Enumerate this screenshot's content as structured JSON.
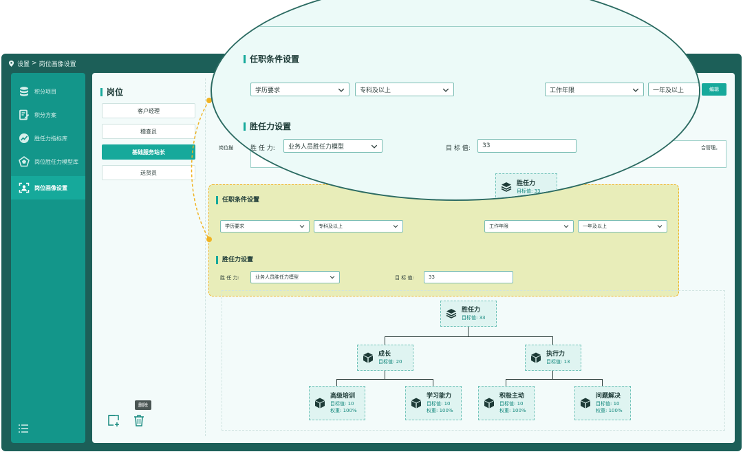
{
  "breadcrumb": {
    "root": "设置",
    "separator": ">",
    "current": "岗位画像设置"
  },
  "sidebar": {
    "items": [
      {
        "label": "积分项目",
        "icon": "database-icon"
      },
      {
        "label": "积分方案",
        "icon": "edit-document-icon"
      },
      {
        "label": "胜任力指标库",
        "icon": "chart-trend-icon"
      },
      {
        "label": "岗位胜任力模型库",
        "icon": "pentagon-icon"
      },
      {
        "label": "岗位画像设置",
        "icon": "portrait-icon",
        "active": true
      }
    ]
  },
  "posts": {
    "title": "岗位",
    "items": [
      {
        "label": "客户经理"
      },
      {
        "label": "稽查员"
      },
      {
        "label": "基础服务站长",
        "active": true
      },
      {
        "label": "送货员"
      }
    ],
    "delete_tooltip": "删除"
  },
  "content": {
    "edit_label": "编辑",
    "description_label": "岗位描",
    "description_text": "合管理。"
  },
  "qualification": {
    "title": "任职条件设置",
    "education_label": "学历要求",
    "education_value": "专科及以上",
    "experience_label": "工作年限",
    "experience_value": "一年及以上"
  },
  "competency": {
    "title": "胜任力设置",
    "model_label": "胜 任 力:",
    "model_value": "业务人员胜任力模型",
    "target_label": "目 标 值:",
    "target_value": "33"
  },
  "tree": {
    "root": {
      "title": "胜任力",
      "target": "目标值: 33"
    },
    "children": [
      {
        "title": "成长",
        "target": "目标值: 20"
      },
      {
        "title": "执行力",
        "target": "目标值: 13"
      }
    ],
    "leaves": [
      {
        "title": "高级培训",
        "target": "目标值: 10",
        "weight": "权重: 100%"
      },
      {
        "title": "学习能力",
        "target": "目标值: 10",
        "weight": "权重: 100%"
      },
      {
        "title": "积极主动",
        "target": "目标值: 10",
        "weight": "权重: 100%"
      },
      {
        "title": "问题解决",
        "target": "目标值: 10",
        "weight": "权重: 100%"
      }
    ],
    "partial_root": {
      "title": "胜任力",
      "target": "目标值: 33"
    }
  },
  "colors": {
    "accent": "#16a99b",
    "sidebar": "#13968a",
    "frame": "#1c5f58",
    "highlight": "#e8edb9",
    "highlight_border": "#f0b323"
  }
}
